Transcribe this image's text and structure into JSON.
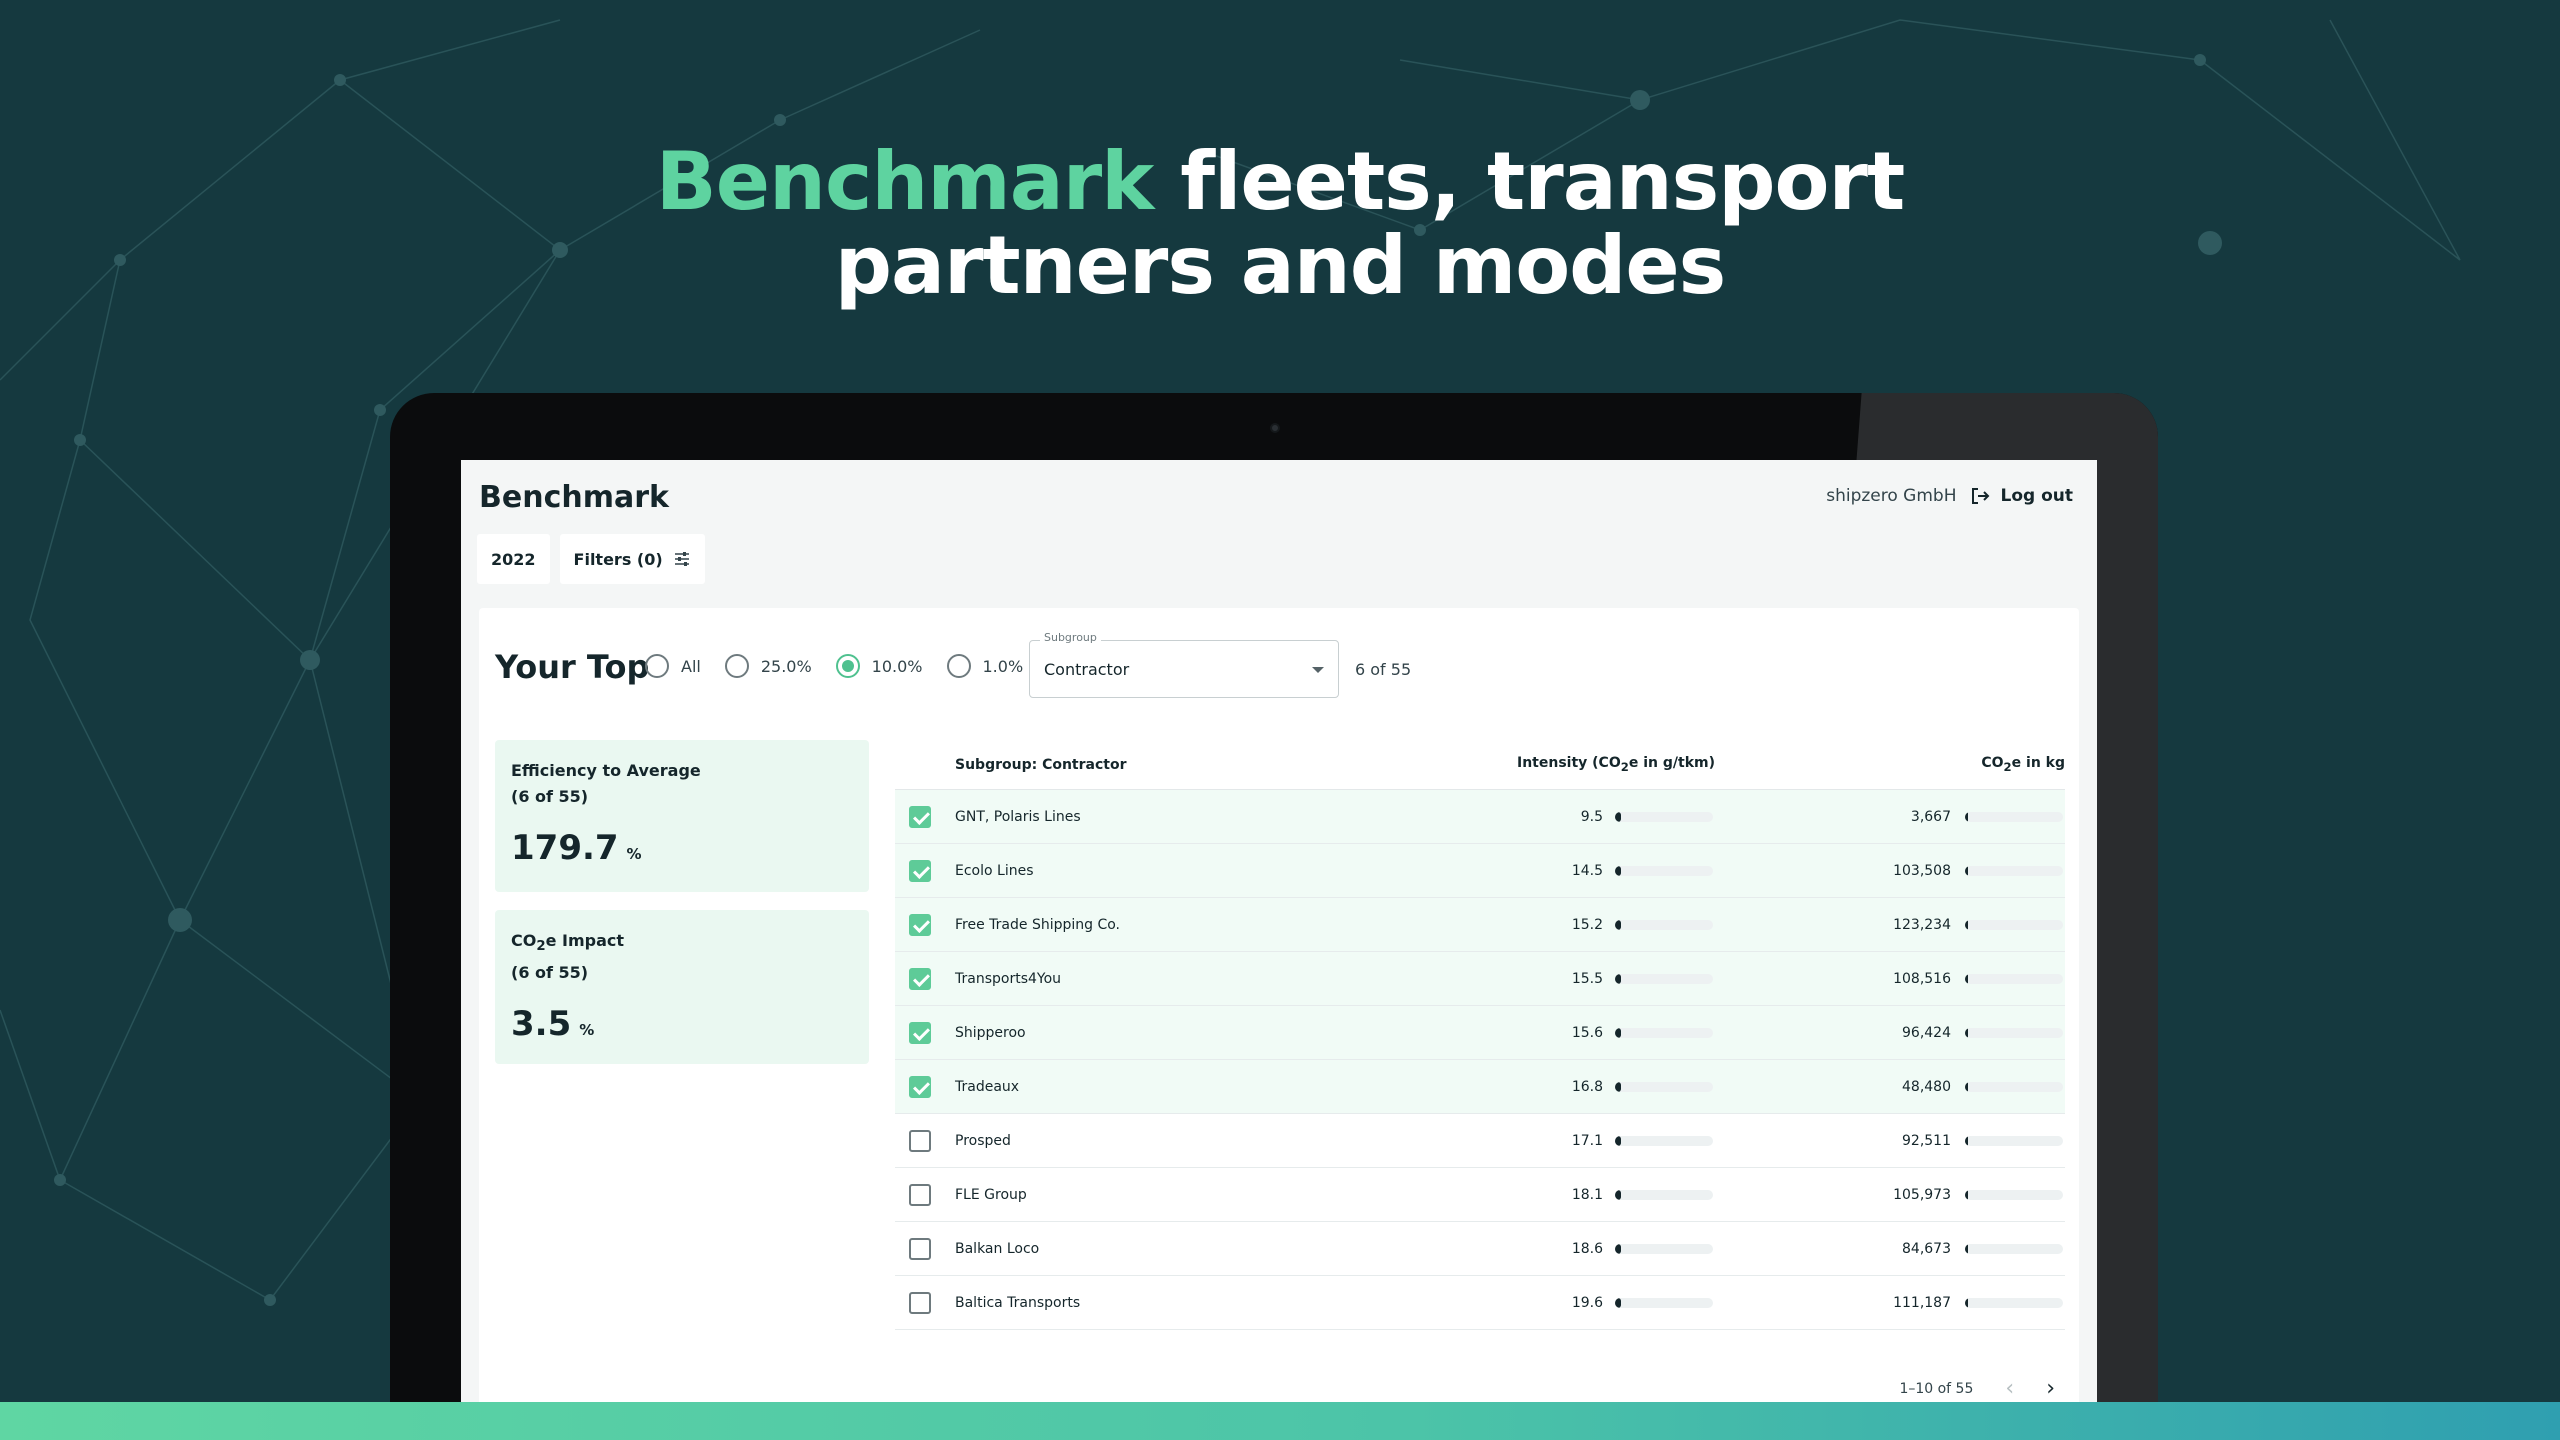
{
  "headline": {
    "highlight": "Benchmark",
    "rest_line1": " fleets, transport",
    "line2": "partners and modes"
  },
  "app": {
    "title": "Benchmark",
    "organization": "shipzero GmbH",
    "logout_label": "Log out",
    "year_label": "2022",
    "filters_label": "Filters (0)"
  },
  "top": {
    "label": "Your Top",
    "options": [
      {
        "label": "All",
        "selected": false
      },
      {
        "label": "25.0%",
        "selected": false
      },
      {
        "label": "10.0%",
        "selected": true
      },
      {
        "label": "1.0%",
        "selected": false
      }
    ],
    "subgroup_label": "Subgroup",
    "subgroup_value": "Contractor",
    "count": "6 of 55"
  },
  "kpis": [
    {
      "title_line1": "Efficiency to Average",
      "title_line2": "(6 of 55)",
      "value": "179.7",
      "unit": "%"
    },
    {
      "title_prefix": "CO",
      "title_sub": "2",
      "title_suffix": "e Impact",
      "title_line2": "(6 of 55)",
      "value": "3.5",
      "unit": "%"
    }
  ],
  "table": {
    "headers": {
      "name": "Subgroup: Contractor",
      "intensity_prefix": "Intensity (CO",
      "intensity_sub": "2",
      "intensity_suffix": "e in g/tkm)",
      "co2_prefix": "CO",
      "co2_sub": "2",
      "co2_suffix": "e in kg"
    },
    "intensity_max": 400,
    "co2_max": 20000000,
    "rows": [
      {
        "checked": true,
        "name": "GNT, Polaris Lines",
        "intensity": 9.5,
        "intensity_label": "9.5",
        "co2": 3667,
        "co2_label": "3,667"
      },
      {
        "checked": true,
        "name": "Ecolo Lines",
        "intensity": 14.5,
        "intensity_label": "14.5",
        "co2": 103508,
        "co2_label": "103,508"
      },
      {
        "checked": true,
        "name": "Free Trade Shipping Co.",
        "intensity": 15.2,
        "intensity_label": "15.2",
        "co2": 123234,
        "co2_label": "123,234"
      },
      {
        "checked": true,
        "name": "Transports4You",
        "intensity": 15.5,
        "intensity_label": "15.5",
        "co2": 108516,
        "co2_label": "108,516"
      },
      {
        "checked": true,
        "name": "Shipperoo",
        "intensity": 15.6,
        "intensity_label": "15.6",
        "co2": 96424,
        "co2_label": "96,424"
      },
      {
        "checked": true,
        "name": "Tradeaux",
        "intensity": 16.8,
        "intensity_label": "16.8",
        "co2": 48480,
        "co2_label": "48,480"
      },
      {
        "checked": false,
        "name": "Prosped",
        "intensity": 17.1,
        "intensity_label": "17.1",
        "co2": 92511,
        "co2_label": "92,511"
      },
      {
        "checked": false,
        "name": "FLE Group",
        "intensity": 18.1,
        "intensity_label": "18.1",
        "co2": 105973,
        "co2_label": "105,973"
      },
      {
        "checked": false,
        "name": "Balkan Loco",
        "intensity": 18.6,
        "intensity_label": "18.6",
        "co2": 84673,
        "co2_label": "84,673"
      },
      {
        "checked": false,
        "name": "Baltica Transports",
        "intensity": 19.6,
        "intensity_label": "19.6",
        "co2": 111187,
        "co2_label": "111,187"
      }
    ],
    "pagination": "1–10 of 55"
  },
  "icons": {
    "logout": "logout-icon",
    "filter": "sliders-icon",
    "prev": "chevron-left-icon",
    "next": "chevron-right-icon"
  },
  "colors": {
    "background": "#15393f",
    "accent": "#5ed3a0",
    "check": "#5ecb98",
    "kpi_bg": "#eaf8f1"
  }
}
